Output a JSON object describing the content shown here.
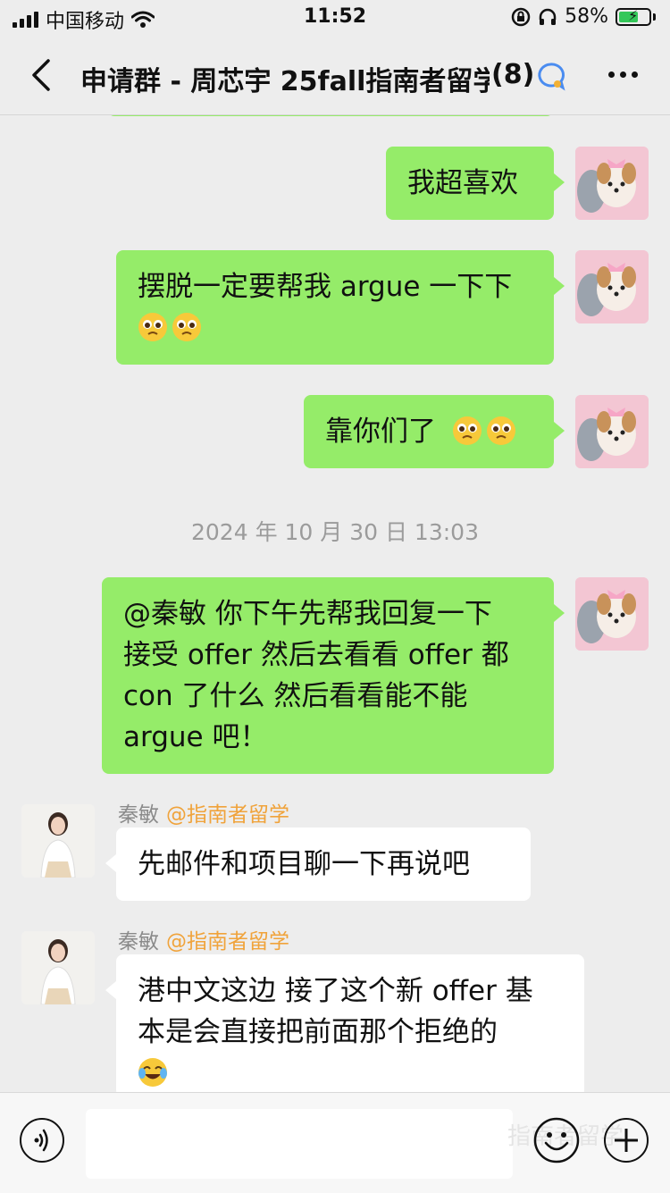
{
  "status": {
    "carrier": "中国移动",
    "time": "11:52",
    "battery": "58%"
  },
  "header": {
    "title": "申请群 - 周芯宇 25fall指南者留学",
    "count": "(8)"
  },
  "messages": [
    {
      "side": "right",
      "text": "我超喜欢"
    },
    {
      "side": "right",
      "line1": "摆脱一定要帮我 argue 一下下",
      "emoji": [
        "pleading-face",
        "pleading-face"
      ]
    },
    {
      "side": "right",
      "text": "靠你们了",
      "emoji": [
        "pleading-face",
        "pleading-face"
      ]
    },
    {
      "side": "right",
      "lines": [
        "@秦敏 你下午先帮我回复一下",
        "接受 offer 然后去看看 offer 都",
        "con 了什么 然后看看能不能",
        "argue 吧！"
      ]
    },
    {
      "side": "left",
      "sender": "秦敏",
      "tag": "@指南者留学",
      "text": "先邮件和项目聊一下再说吧"
    },
    {
      "side": "left",
      "sender": "秦敏",
      "tag": "@指南者留学",
      "lines": [
        "港中文这边 接了这个新 offer 基",
        "本是会直接把前面那个拒绝的"
      ],
      "emoji": [
        "tears-of-joy"
      ]
    }
  ],
  "timestamp": "2024 年 10 月 30 日 13:03",
  "input": {
    "watermark": "指南者留学"
  },
  "colors": {
    "self_bubble": "#95ec69",
    "other_bubble": "#ffffff",
    "background": "#ededed",
    "tag": "#f0a33b"
  }
}
